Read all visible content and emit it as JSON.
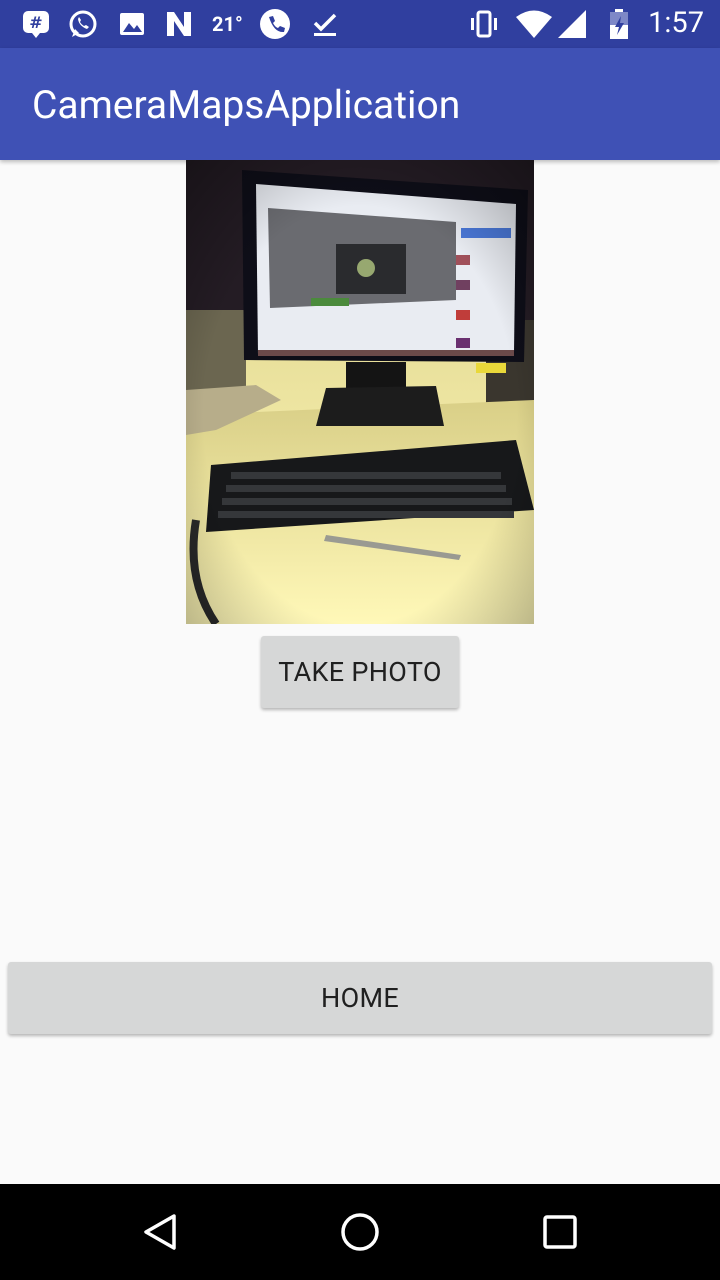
{
  "status_bar": {
    "temperature": "21°",
    "time": "1:57",
    "icons": [
      "chat-notification-icon",
      "whatsapp-icon",
      "image-icon",
      "n-icon",
      "phone-icon",
      "check-icon",
      "vibrate-icon",
      "wifi-icon",
      "signal-icon",
      "battery-icon"
    ]
  },
  "app_bar": {
    "title": "CameraMapsApplication"
  },
  "main": {
    "take_photo_label": "TAKE PHOTO",
    "home_label": "HOME"
  },
  "nav_bar": {
    "icons": [
      "back-icon",
      "home-circle-icon",
      "recents-icon"
    ]
  },
  "colors": {
    "status_bar": "#303f9f",
    "app_bar": "#3f51b5",
    "background": "#fafafa",
    "button": "#d6d7d7"
  }
}
